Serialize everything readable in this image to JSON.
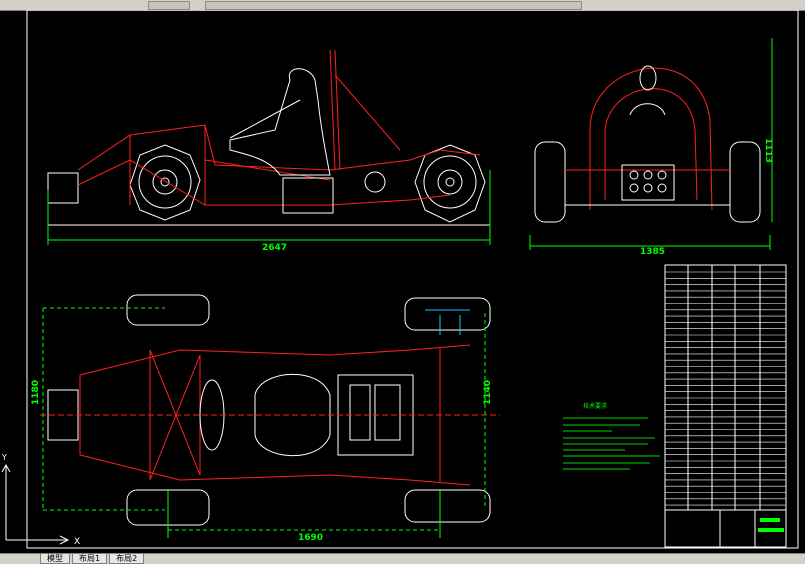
{
  "toolbar": {
    "item_1": "",
    "item_2": ""
  },
  "drawing": {
    "dim_side_length": "2647",
    "dim_front_height": "1113",
    "dim_front_width": "1385",
    "dim_top_left_width": "1180",
    "dim_top_right_width": "1140",
    "dim_wheelbase": "1690",
    "tech_requirements_title": "技术要求",
    "tech_requirements_lines": [
      "",
      "",
      "",
      "",
      "",
      "",
      "",
      "",
      ""
    ]
  },
  "ucs": {
    "y_label": "Y",
    "x_label": "X"
  },
  "tabs": {
    "model": "模型",
    "layout1": "布局1",
    "layout2": "布局2"
  },
  "colors": {
    "frame": "#ff2020",
    "line": "#ffffff",
    "dimension": "#00ff00",
    "hidden": "#00d0ff",
    "background": "#000000"
  }
}
